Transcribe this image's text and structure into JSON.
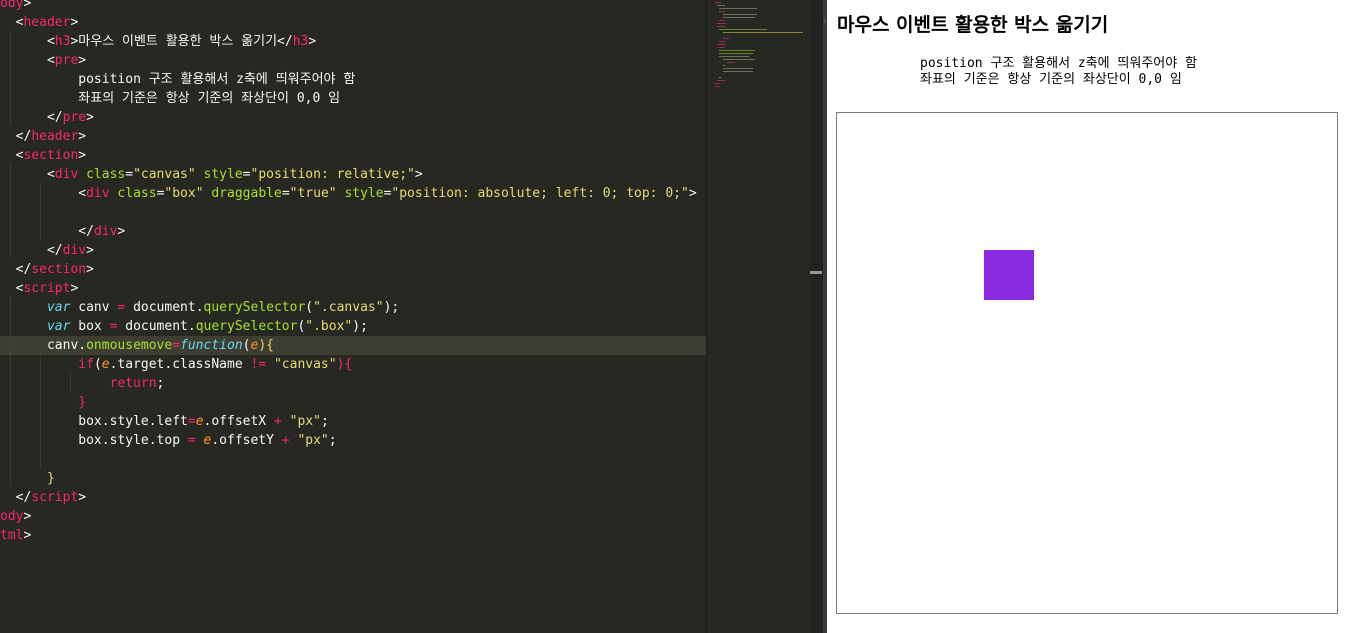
{
  "editor": {
    "lines": [
      [
        [
          "ody",
          "tag"
        ],
        [
          ">",
          "txt"
        ]
      ],
      [
        [
          "  ",
          "txt"
        ],
        [
          "<",
          "txt"
        ],
        [
          "header",
          "tag"
        ],
        [
          ">",
          "txt"
        ]
      ],
      [
        [
          "      ",
          "txt"
        ],
        [
          "<",
          "txt"
        ],
        [
          "h3",
          "tag"
        ],
        [
          ">",
          "txt"
        ],
        [
          "마우스 이벤트 활용한 박스 옮기기",
          "txt"
        ],
        [
          "</",
          "txt"
        ],
        [
          "h3",
          "tag"
        ],
        [
          ">",
          "txt"
        ]
      ],
      [
        [
          "      ",
          "txt"
        ],
        [
          "<",
          "txt"
        ],
        [
          "pre",
          "tag"
        ],
        [
          ">",
          "txt"
        ]
      ],
      [
        [
          "          ",
          "txt"
        ],
        [
          "position 구조 활용해서 z축에 띄워주어야 함",
          "txt"
        ]
      ],
      [
        [
          "          ",
          "txt"
        ],
        [
          "좌표의 기준은 항상 기준의 좌상단이 0,0 임",
          "txt"
        ]
      ],
      [
        [
          "      ",
          "txt"
        ],
        [
          "</",
          "txt"
        ],
        [
          "pre",
          "tag"
        ],
        [
          ">",
          "txt"
        ]
      ],
      [
        [
          "  ",
          "txt"
        ],
        [
          "</",
          "txt"
        ],
        [
          "header",
          "tag"
        ],
        [
          ">",
          "txt"
        ]
      ],
      [
        [
          "  ",
          "txt"
        ],
        [
          "<",
          "txt"
        ],
        [
          "section",
          "tag"
        ],
        [
          ">",
          "txt"
        ]
      ],
      [
        [
          "      ",
          "txt"
        ],
        [
          "<",
          "txt"
        ],
        [
          "div",
          "tag"
        ],
        [
          " ",
          "txt"
        ],
        [
          "class",
          "attr"
        ],
        [
          "=",
          "txt"
        ],
        [
          "\"canvas\"",
          "str"
        ],
        [
          " ",
          "txt"
        ],
        [
          "style",
          "attr"
        ],
        [
          "=",
          "txt"
        ],
        [
          "\"position: relative;\"",
          "str"
        ],
        [
          ">",
          "txt"
        ]
      ],
      [
        [
          "          ",
          "txt"
        ],
        [
          "<",
          "txt"
        ],
        [
          "div",
          "tag"
        ],
        [
          " ",
          "txt"
        ],
        [
          "class",
          "attr"
        ],
        [
          "=",
          "txt"
        ],
        [
          "\"box\"",
          "str"
        ],
        [
          " ",
          "txt"
        ],
        [
          "draggable",
          "attr"
        ],
        [
          "=",
          "txt"
        ],
        [
          "\"true\"",
          "str"
        ],
        [
          " ",
          "txt"
        ],
        [
          "style",
          "attr"
        ],
        [
          "=",
          "txt"
        ],
        [
          "\"position: absolute; left: 0; top: 0;\"",
          "str"
        ],
        [
          ">",
          "txt"
        ]
      ],
      [
        [
          "",
          "txt"
        ]
      ],
      [
        [
          "          ",
          "txt"
        ],
        [
          "</",
          "txt"
        ],
        [
          "div",
          "tag"
        ],
        [
          ">",
          "txt"
        ]
      ],
      [
        [
          "      ",
          "txt"
        ],
        [
          "</",
          "txt"
        ],
        [
          "div",
          "tag"
        ],
        [
          ">",
          "txt"
        ]
      ],
      [
        [
          "  ",
          "txt"
        ],
        [
          "</",
          "txt"
        ],
        [
          "section",
          "tag"
        ],
        [
          ">",
          "txt"
        ]
      ],
      [
        [
          "  ",
          "txt"
        ],
        [
          "<",
          "txt"
        ],
        [
          "script",
          "tag"
        ],
        [
          ">",
          "txt"
        ]
      ],
      [
        [
          "      ",
          "txt"
        ],
        [
          "var",
          "kw"
        ],
        [
          " canv ",
          "txt"
        ],
        [
          "=",
          "op"
        ],
        [
          " document.",
          "txt"
        ],
        [
          "querySelector",
          "fn"
        ],
        [
          "(",
          "txt"
        ],
        [
          "\".canvas\"",
          "str"
        ],
        [
          ");",
          "txt"
        ]
      ],
      [
        [
          "      ",
          "txt"
        ],
        [
          "var",
          "kw"
        ],
        [
          " box ",
          "txt"
        ],
        [
          "=",
          "op"
        ],
        [
          " document.",
          "txt"
        ],
        [
          "querySelector",
          "fn"
        ],
        [
          "(",
          "txt"
        ],
        [
          "\".box\"",
          "str"
        ],
        [
          ");",
          "txt"
        ]
      ],
      [
        [
          "      ",
          "txt"
        ],
        [
          "canv.",
          "txt"
        ],
        [
          "onmousemove",
          "fn"
        ],
        [
          "=",
          "op"
        ],
        [
          "function",
          "kw"
        ],
        [
          "(",
          "txt"
        ],
        [
          "e",
          "param"
        ],
        [
          "){",
          "brace"
        ]
      ],
      [
        [
          "          ",
          "txt"
        ],
        [
          "if",
          "ctl"
        ],
        [
          "(",
          "txt"
        ],
        [
          "e",
          "param"
        ],
        [
          ".target.className ",
          "txt"
        ],
        [
          "!=",
          "op"
        ],
        [
          " ",
          "txt"
        ],
        [
          "\"canvas\"",
          "str"
        ],
        [
          "){",
          "ctl"
        ]
      ],
      [
        [
          "              ",
          "txt"
        ],
        [
          "return",
          "ctl"
        ],
        [
          ";",
          "txt"
        ]
      ],
      [
        [
          "          ",
          "txt"
        ],
        [
          "}",
          "ctl"
        ]
      ],
      [
        [
          "          ",
          "txt"
        ],
        [
          "box.style.left",
          "txt"
        ],
        [
          "=",
          "op"
        ],
        [
          "e",
          "param"
        ],
        [
          ".offsetX ",
          "txt"
        ],
        [
          "+",
          "op"
        ],
        [
          " ",
          "txt"
        ],
        [
          "\"px\"",
          "str"
        ],
        [
          ";",
          "txt"
        ]
      ],
      [
        [
          "          ",
          "txt"
        ],
        [
          "box.style.top ",
          "txt"
        ],
        [
          "=",
          "op"
        ],
        [
          " ",
          "txt"
        ],
        [
          "e",
          "param"
        ],
        [
          ".offsetY ",
          "txt"
        ],
        [
          "+",
          "op"
        ],
        [
          " ",
          "txt"
        ],
        [
          "\"px\"",
          "str"
        ],
        [
          ";",
          "txt"
        ]
      ],
      [
        [
          "",
          "txt"
        ]
      ],
      [
        [
          "      ",
          "txt"
        ],
        [
          "}",
          "brace"
        ]
      ],
      [
        [
          "  ",
          "txt"
        ],
        [
          "</",
          "txt"
        ],
        [
          "script",
          "tag"
        ],
        [
          ">",
          "txt"
        ]
      ],
      [
        [
          "ody",
          "tag"
        ],
        [
          ">",
          "txt"
        ]
      ],
      [
        [
          "tml",
          "tag"
        ],
        [
          ">",
          "txt"
        ]
      ]
    ],
    "active_line": 18
  },
  "preview": {
    "title": "마우스 이벤트 활용한 박스 옮기기",
    "pre_lines": [
      "position 구조 활용해서 z축에 띄워주어야 함",
      "좌표의 기준은 항상 기준의 좌상단이 0,0 임"
    ],
    "box_color": "#8a2be2"
  },
  "colors": {
    "tag": "#f92672",
    "attr": "#a6e22e",
    "string": "#e6db74",
    "keyword": "#66d9ef",
    "param": "#fd971f",
    "editor_bg": "#272822"
  },
  "icons": {
    "preview_arrow": "chevron-left-icon"
  }
}
